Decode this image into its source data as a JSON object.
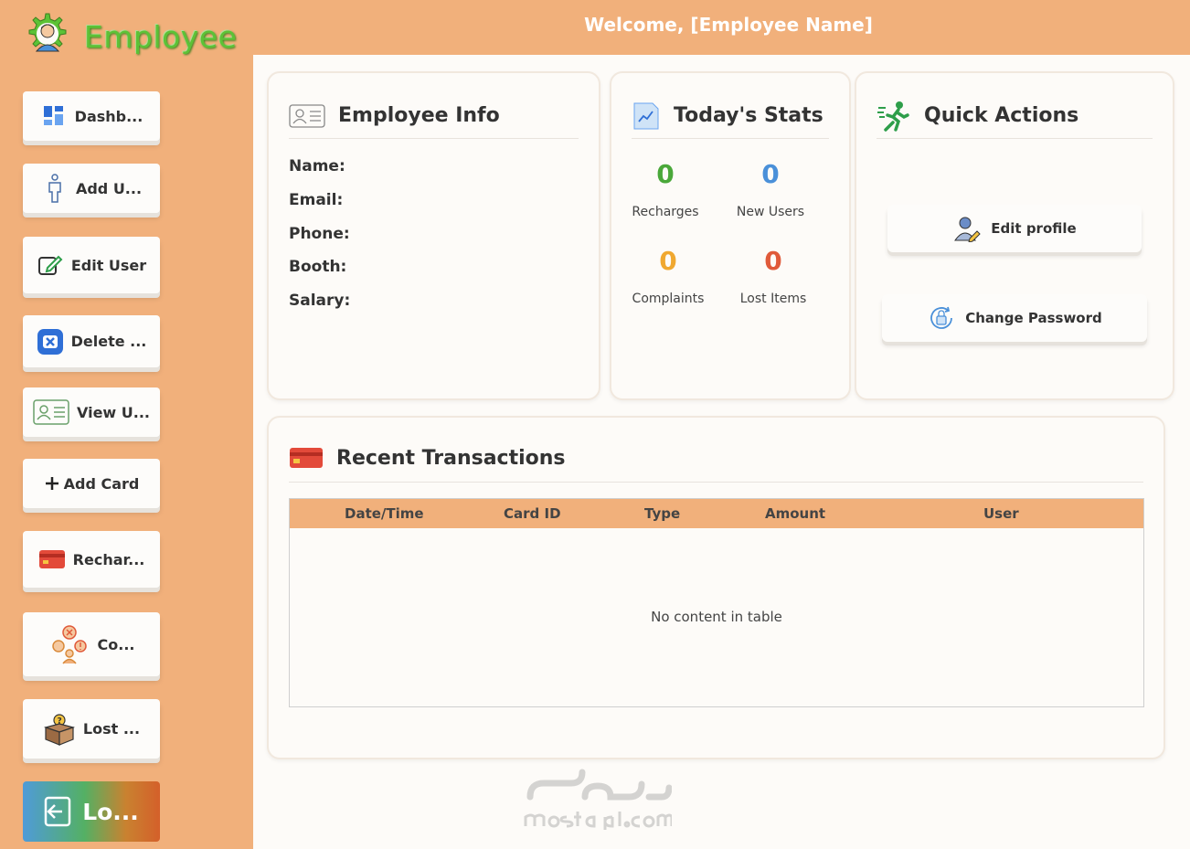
{
  "app": {
    "logo_text": "Employee"
  },
  "header": {
    "title": "Welcome, [Employee Name]"
  },
  "sidebar": {
    "items": [
      {
        "label": "Dashb...",
        "icon": "dashboard-icon"
      },
      {
        "label": "Add U...",
        "icon": "add-user-icon"
      },
      {
        "label": "Edit User",
        "icon": "edit-icon"
      },
      {
        "label": "Delete ...",
        "icon": "delete-icon"
      },
      {
        "label": "View U...",
        "icon": "id-card-icon"
      },
      {
        "label": "Add Card",
        "icon": "plus-icon"
      },
      {
        "label": "Rechar...",
        "icon": "credit-card-icon"
      },
      {
        "label": "Co...",
        "icon": "complaints-icon"
      },
      {
        "label": "Lost ...",
        "icon": "lost-box-icon"
      }
    ],
    "logout": {
      "label": "Lo...",
      "icon": "logout-icon"
    }
  },
  "employee_info": {
    "title": "Employee Info",
    "fields": [
      "Name:",
      "Email:",
      "Phone:",
      "Booth:",
      "Salary:"
    ]
  },
  "stats": {
    "title": "Today's Stats",
    "items": [
      {
        "value": "0",
        "label": "Recharges",
        "color": "#4aa83a"
      },
      {
        "value": "0",
        "label": "New Users",
        "color": "#4a90d9"
      },
      {
        "value": "0",
        "label": "Complaints",
        "color": "#f0a830"
      },
      {
        "value": "0",
        "label": "Lost Items",
        "color": "#e05a3a"
      }
    ]
  },
  "quick_actions": {
    "title": "Quick Actions",
    "edit_profile": "Edit profile",
    "change_password": "Change Password"
  },
  "transactions": {
    "title": "Recent Transactions",
    "columns": [
      "Date/Time",
      "Card ID",
      "Type",
      "Amount",
      "User"
    ],
    "empty_text": "No content in table"
  },
  "colors": {
    "accent": "#f1b07b",
    "background": "#fdfbf8"
  }
}
